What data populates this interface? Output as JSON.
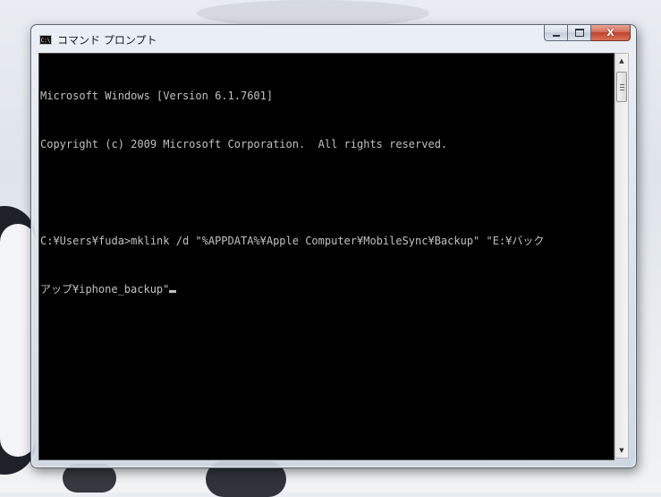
{
  "window": {
    "title": "コマンド プロンプト",
    "icon": "cmd-icon",
    "icon_text": "C:\\",
    "buttons": {
      "minimize": "minimize-icon",
      "maximize": "maximize-icon",
      "close_label": "X"
    }
  },
  "console": {
    "lines": [
      "Microsoft Windows [Version 6.1.7601]",
      "Copyright (c) 2009 Microsoft Corporation.  All rights reserved.",
      "",
      "C:¥Users¥fuda>mklink /d \"%APPDATA%¥Apple Computer¥MobileSync¥Backup\" \"E:¥バック",
      "アップ¥iphone_backup\""
    ],
    "text_color": "#c0c0c0",
    "background": "#000000"
  },
  "scrollbar": {
    "up_arrow": "▲",
    "down_arrow": "▼"
  }
}
